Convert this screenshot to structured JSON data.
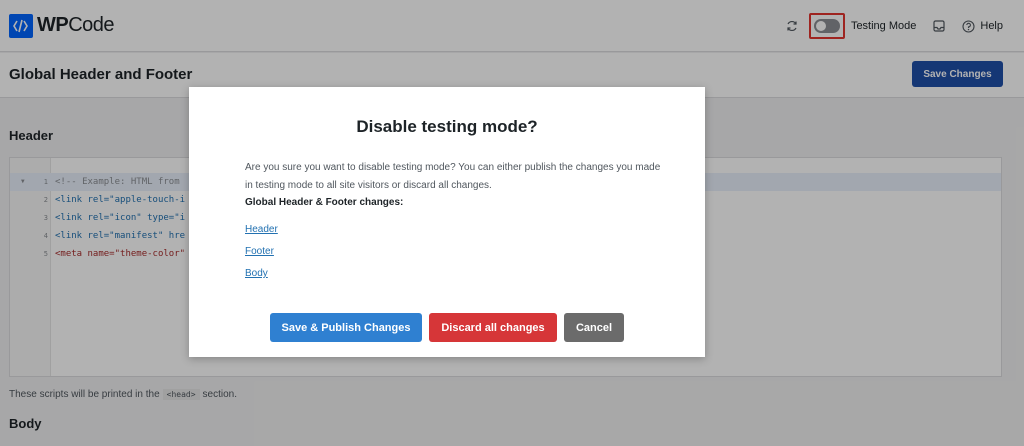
{
  "app": {
    "logo_bold": "WP",
    "logo_rest": "Code"
  },
  "topbar": {
    "testing_mode_label": "Testing Mode",
    "help_label": "Help",
    "icons": [
      "refresh-icon",
      "testing-mode-toggle",
      "notifications-icon",
      "help-icon"
    ]
  },
  "page": {
    "title": "Global Header and Footer",
    "save_label": "Save Changes",
    "header_section": "Header",
    "body_section": "Body",
    "helper_before": "These scripts will be printed in the",
    "helper_code": "<head>",
    "helper_after": "section."
  },
  "editor": {
    "lines": [
      {
        "num": "1",
        "text": "<!-- Example: HTML from"
      },
      {
        "num": "2",
        "text": "<link rel=\"apple-touch-i"
      },
      {
        "num": "3",
        "text": "<link rel=\"icon\" type=\"i"
      },
      {
        "num": "4",
        "text": "<link rel=\"manifest\" hre"
      },
      {
        "num": "5",
        "text": "<meta name=\"theme-color\""
      }
    ]
  },
  "modal": {
    "title": "Disable testing mode?",
    "description": "Are you sure you want to disable testing mode? You can either publish the changes you made in testing mode to all site visitors or discard all changes.",
    "subheading": "Global Header & Footer changes:",
    "links": [
      "Header",
      "Footer",
      "Body"
    ],
    "publish_label": "Save & Publish Changes",
    "discard_label": "Discard all changes",
    "cancel_label": "Cancel"
  },
  "colors": {
    "accent": "#1f4fa8",
    "publish": "#2f80d1",
    "discard": "#d63638",
    "cancel": "#6b6b6b",
    "highlight": "#e3342f"
  }
}
